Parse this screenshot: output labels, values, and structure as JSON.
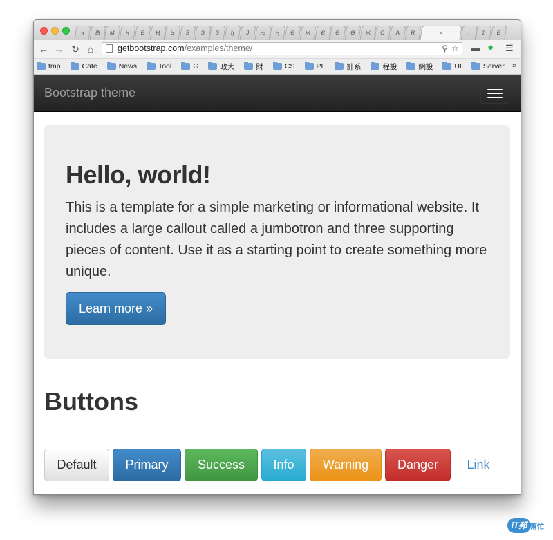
{
  "browser": {
    "tabs": [
      "ч",
      "百",
      "М",
      "Ч",
      "Е",
      "Ң",
      "Ь",
      "Ѕ",
      "Ѕ",
      "Ѕ",
      "ђ",
      "Ј",
      "Њ",
      "Ӊ",
      "Ө",
      "Ж",
      "Є",
      "Ө",
      "Ө",
      "Ӝ",
      "Ӧ",
      "Ӑ",
      "Ř"
    ],
    "active_tab_close": "×",
    "extra_tabs": [
      "і",
      "ž",
      "Ӗ"
    ],
    "url_host": "getbootstrap.com",
    "url_path": "/examples/theme/",
    "bookmarks": [
      "tmp",
      "Cate",
      "News",
      "Tool",
      "G",
      "政大",
      "財",
      "CS",
      "PL",
      "計系",
      "程設",
      "網設",
      "UI",
      "Server"
    ],
    "bookmarks_more": "»"
  },
  "page": {
    "brand": "Bootstrap theme",
    "jumbotron": {
      "title": "Hello, world!",
      "text": "This is a template for a simple marketing or informational website. It includes a large callout called a jumbotron and three supporting pieces of content. Use it as a starting point to create something more unique.",
      "button": "Learn more »"
    },
    "buttons_section": {
      "title": "Buttons",
      "buttons": [
        "Default",
        "Primary",
        "Success",
        "Info",
        "Warning",
        "Danger",
        "Link"
      ]
    }
  },
  "watermark": {
    "logo": "iT邦",
    "text": "幫忙"
  }
}
